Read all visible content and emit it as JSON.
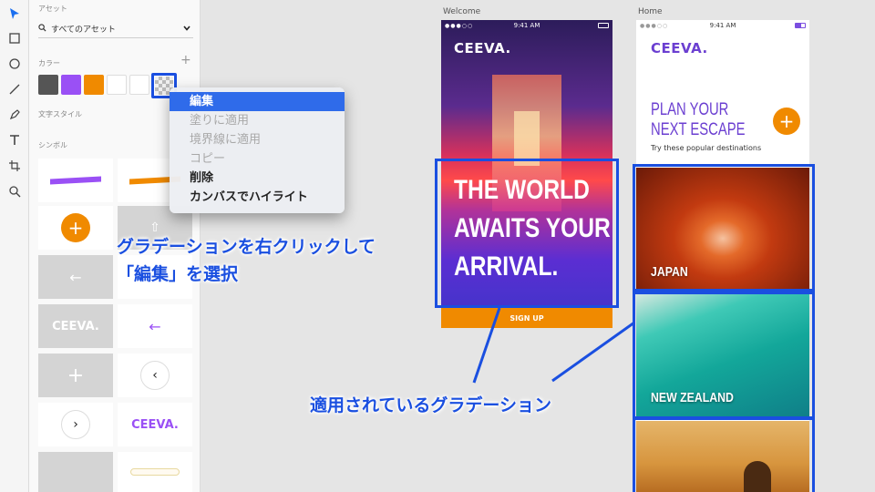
{
  "assets_panel": {
    "section_assets": "アセット",
    "asset_filter": "すべてのアセット",
    "section_colors": "カラー",
    "section_text_styles": "文字スタイル",
    "section_symbols": "シンボル",
    "colors": [
      "#555555",
      "#9a50f5",
      "#f08a00",
      "#ffffff",
      "#ffffff"
    ]
  },
  "symbols": {
    "logo_text": "CEEVA."
  },
  "context_menu": {
    "items": [
      {
        "label": "編集"
      },
      {
        "label": "塗りに適用"
      },
      {
        "label": "境界線に適用"
      },
      {
        "label": "コピー"
      },
      {
        "label": "削除"
      },
      {
        "label": "カンバスでハイライト"
      }
    ]
  },
  "annotations": {
    "instruction_line1": "グラデーションを右クリックして",
    "instruction_line2": "「編集」を選択",
    "applied_label": "適用されているグラデーション"
  },
  "artboards": {
    "welcome": {
      "name": "Welcome",
      "time": "9:41 AM",
      "logo": "CEEVA.",
      "headline": [
        "THE WORLD",
        "AWAITS YOUR",
        "ARRIVAL."
      ],
      "signup_label": "SIGN UP"
    },
    "home": {
      "name": "Home",
      "time": "9:41 AM",
      "logo": "CEEVA.",
      "headline": [
        "PLAN YOUR",
        "NEXT ESCAPE"
      ],
      "subtitle": "Try these popular destinations",
      "plus": "+",
      "destinations": [
        "JAPAN",
        "NEW ZEALAND"
      ]
    }
  },
  "colors": {
    "accent_orange": "#f08a00",
    "brand_purple": "#6b3fd1",
    "highlight_blue": "#1a4fe0"
  }
}
